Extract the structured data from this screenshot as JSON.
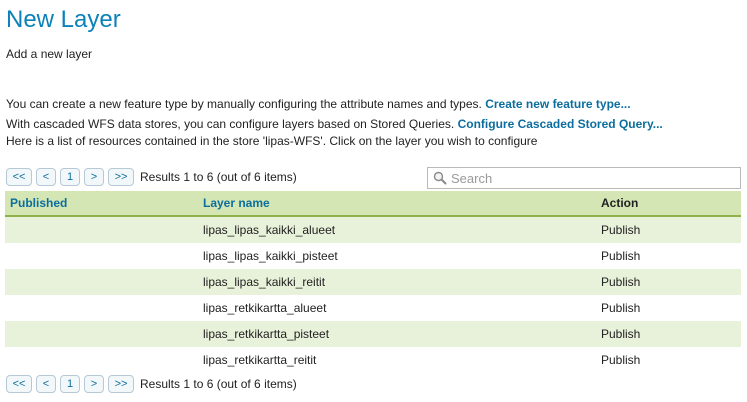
{
  "header": {
    "title": "New Layer",
    "subtitle": "Add a new layer"
  },
  "description": {
    "line1_text": "You can create a new feature type by manually configuring the attribute names and types.",
    "line1_link": "Create new feature type...",
    "line2_text": "With cascaded WFS data stores, you can configure layers based on Stored Queries.",
    "line2_link": "Configure Cascaded Stored Query...",
    "line3_text": "Here is a list of resources contained in the store 'lipas-WFS'. Click on the layer you wish to configure"
  },
  "pager": {
    "first": "<<",
    "prev": "<",
    "page": "1",
    "next": ">",
    "last": ">>",
    "results": "Results 1 to 6 (out of 6 items)"
  },
  "search": {
    "placeholder": "Search"
  },
  "table": {
    "columns": [
      "Published",
      "Layer name",
      "Action"
    ],
    "rows": [
      {
        "published": "",
        "layer": "lipas_lipas_kaikki_alueet",
        "action": "Publish"
      },
      {
        "published": "",
        "layer": "lipas_lipas_kaikki_pisteet",
        "action": "Publish"
      },
      {
        "published": "",
        "layer": "lipas_lipas_kaikki_reitit",
        "action": "Publish"
      },
      {
        "published": "",
        "layer": "lipas_retkikartta_alueet",
        "action": "Publish"
      },
      {
        "published": "",
        "layer": "lipas_retkikartta_pisteet",
        "action": "Publish"
      },
      {
        "published": "",
        "layer": "lipas_retkikartta_reitit",
        "action": "Publish"
      }
    ]
  },
  "colors": {
    "title": "#0b82b7",
    "link": "#0b6e9e",
    "header_bg": "#d4e6b3",
    "row_alt_bg": "#e8f1d9"
  },
  "icons": {
    "search": "magnifier-icon"
  }
}
